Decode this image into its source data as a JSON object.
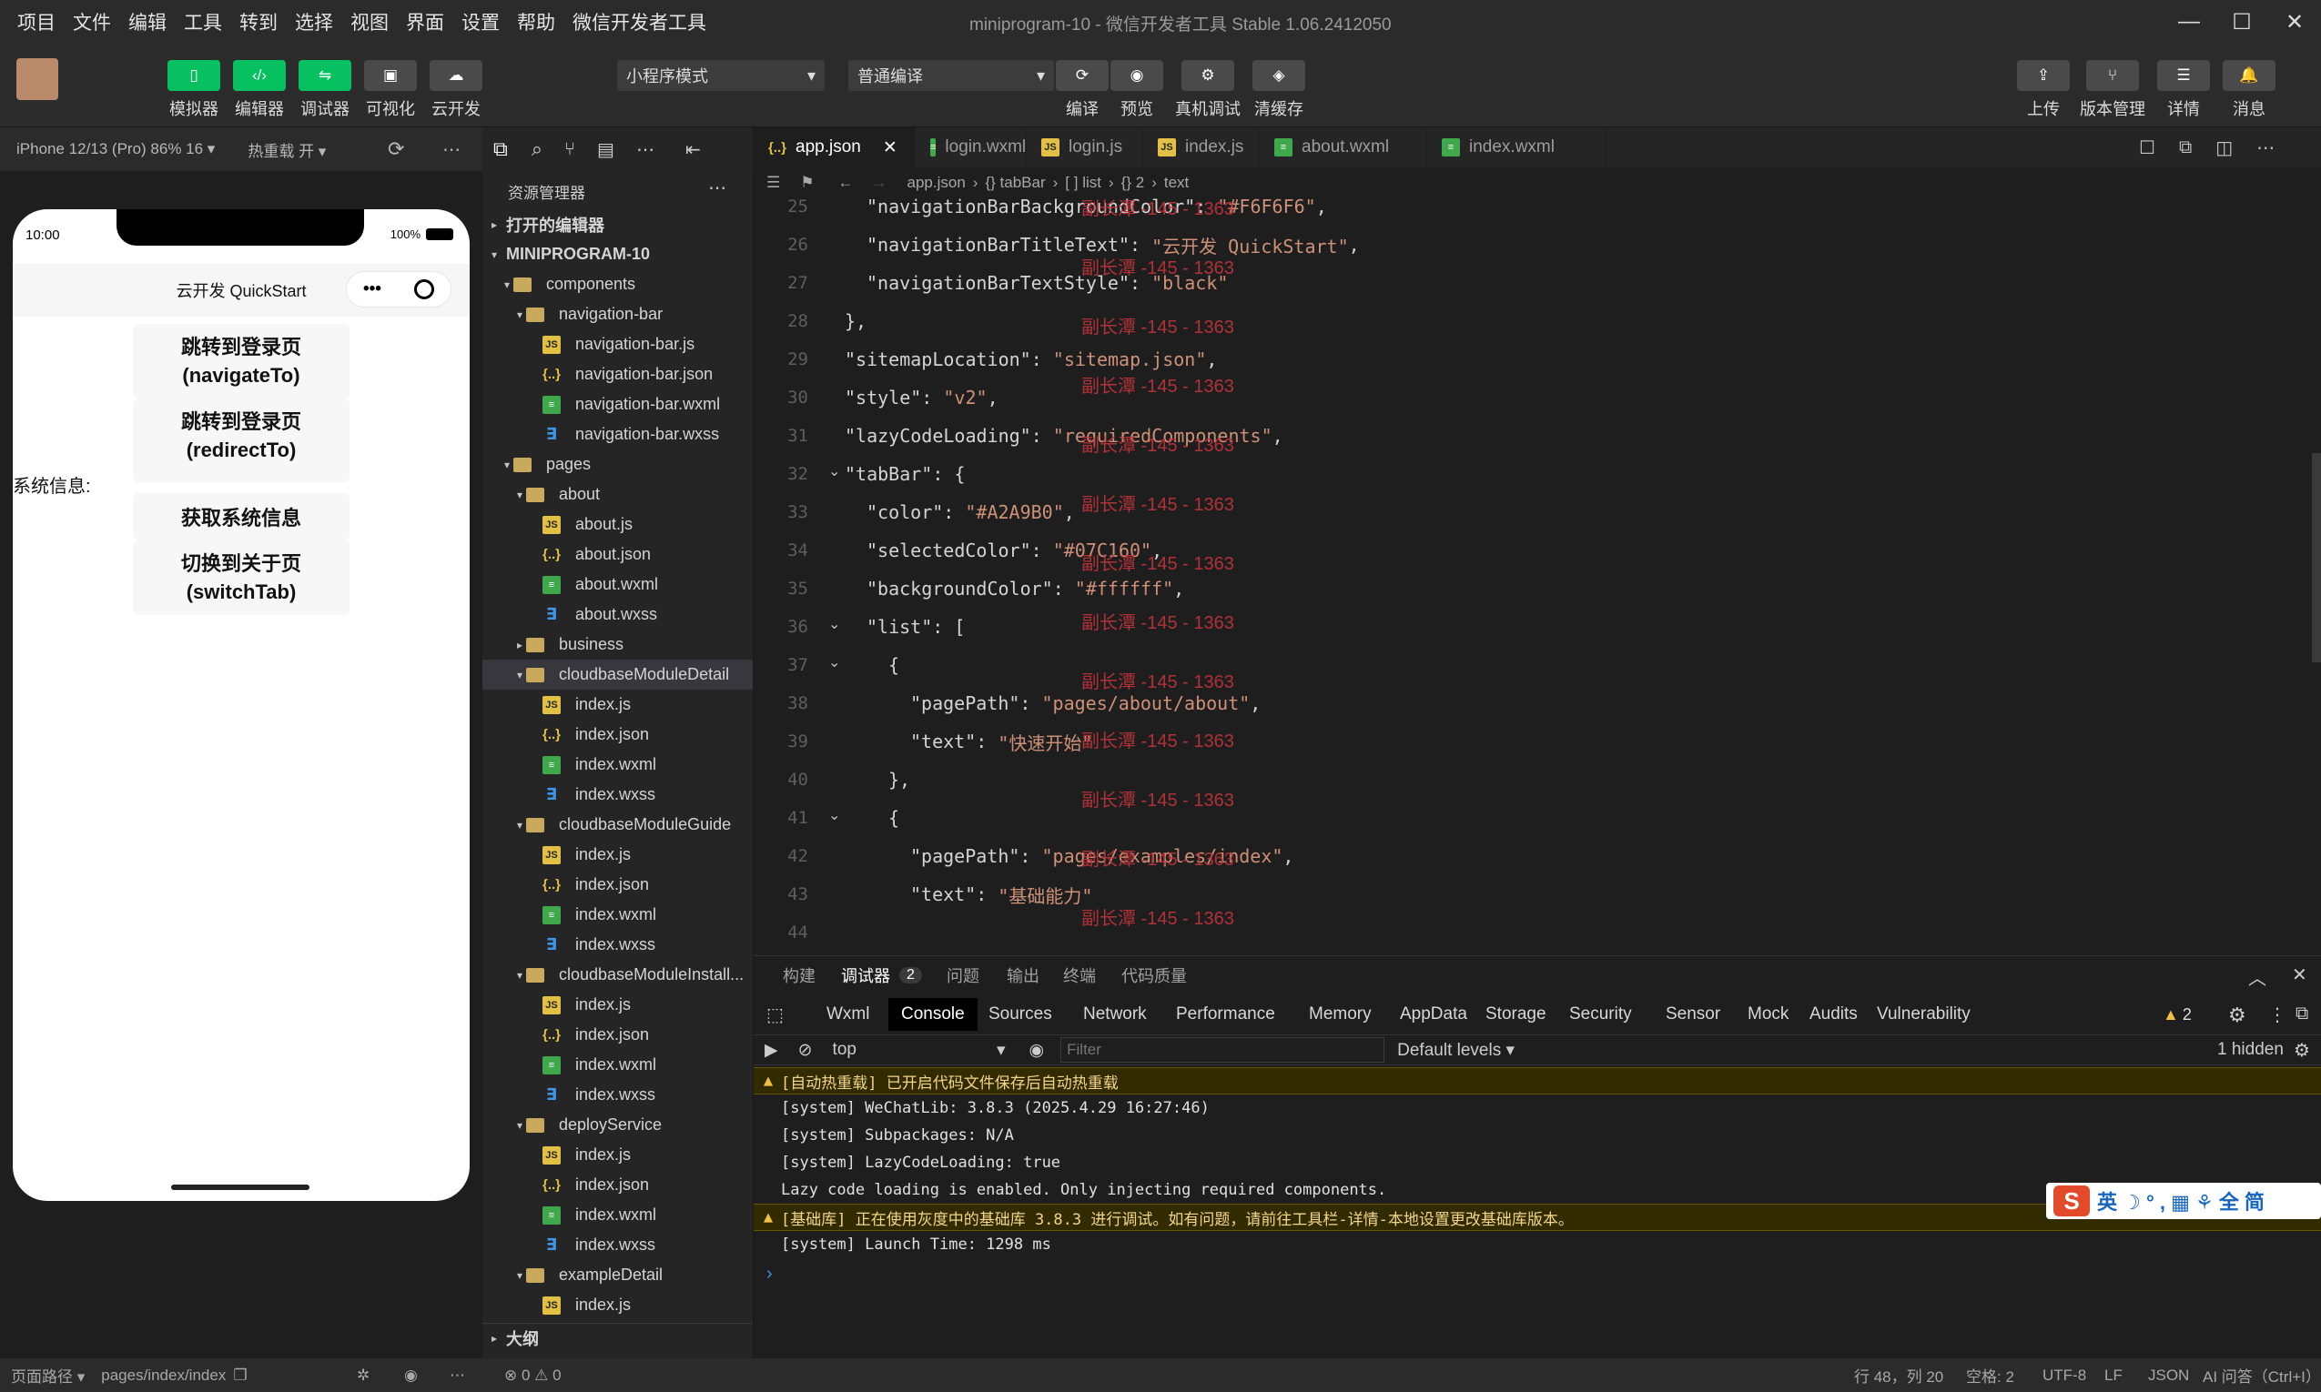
{
  "menu": [
    "项目",
    "文件",
    "编辑",
    "工具",
    "转到",
    "选择",
    "视图",
    "界面",
    "设置",
    "帮助",
    "微信开发者工具"
  ],
  "window_title": "miniprogram-10 - 微信开发者工具 Stable 1.06.2412050",
  "toolbar": {
    "left_buttons": [
      "模拟器",
      "编辑器",
      "调试器",
      "可视化",
      "云开发"
    ],
    "mode_select": "小程序模式",
    "compile_select": "普通编译",
    "mid_buttons": [
      "编译",
      "预览",
      "真机调试",
      "清缓存"
    ],
    "right_buttons": [
      "上传",
      "版本管理",
      "详情",
      "消息"
    ]
  },
  "simbar": {
    "device": "iPhone 12/13 (Pro) 86% 16 ▾",
    "hot_reload": "热重载 开 ▾"
  },
  "phone": {
    "time": "10:00",
    "battery": "100%",
    "title": "云开发 QuickStart",
    "buttons": [
      "跳转到登录页\n(navigateTo)",
      "跳转到登录页\n(redirectTo)",
      "获取系统信息",
      "切换到关于页\n(switchTab)"
    ],
    "sysinfo_label": "系统信息:"
  },
  "simfoot": {
    "path_label": "页面路径 ▾",
    "path": "pages/index/index"
  },
  "explorer": {
    "header": "资源管理器",
    "open_editors": "打开的编辑器",
    "project": "MINIPROGRAM-10",
    "outline": "大纲",
    "tree": [
      {
        "depth": 1,
        "type": "folder",
        "open": true,
        "name": "components"
      },
      {
        "depth": 2,
        "type": "folder",
        "open": true,
        "name": "navigation-bar"
      },
      {
        "depth": 3,
        "type": "js",
        "name": "navigation-bar.js"
      },
      {
        "depth": 3,
        "type": "json",
        "name": "navigation-bar.json"
      },
      {
        "depth": 3,
        "type": "wxml",
        "name": "navigation-bar.wxml"
      },
      {
        "depth": 3,
        "type": "wxss",
        "name": "navigation-bar.wxss"
      },
      {
        "depth": 1,
        "type": "folder",
        "open": true,
        "name": "pages"
      },
      {
        "depth": 2,
        "type": "folder",
        "open": true,
        "name": "about"
      },
      {
        "depth": 3,
        "type": "js",
        "name": "about.js"
      },
      {
        "depth": 3,
        "type": "json",
        "name": "about.json"
      },
      {
        "depth": 3,
        "type": "wxml",
        "name": "about.wxml"
      },
      {
        "depth": 3,
        "type": "wxss",
        "name": "about.wxss"
      },
      {
        "depth": 2,
        "type": "folder",
        "open": false,
        "name": "business"
      },
      {
        "depth": 2,
        "type": "folder",
        "open": true,
        "name": "cloudbaseModuleDetail",
        "selected": true
      },
      {
        "depth": 3,
        "type": "js",
        "name": "index.js"
      },
      {
        "depth": 3,
        "type": "json",
        "name": "index.json"
      },
      {
        "depth": 3,
        "type": "wxml",
        "name": "index.wxml"
      },
      {
        "depth": 3,
        "type": "wxss",
        "name": "index.wxss"
      },
      {
        "depth": 2,
        "type": "folder",
        "open": true,
        "name": "cloudbaseModuleGuide"
      },
      {
        "depth": 3,
        "type": "js",
        "name": "index.js"
      },
      {
        "depth": 3,
        "type": "json",
        "name": "index.json"
      },
      {
        "depth": 3,
        "type": "wxml",
        "name": "index.wxml"
      },
      {
        "depth": 3,
        "type": "wxss",
        "name": "index.wxss"
      },
      {
        "depth": 2,
        "type": "folder",
        "open": true,
        "name": "cloudbaseModuleInstall..."
      },
      {
        "depth": 3,
        "type": "js",
        "name": "index.js"
      },
      {
        "depth": 3,
        "type": "json",
        "name": "index.json"
      },
      {
        "depth": 3,
        "type": "wxml",
        "name": "index.wxml"
      },
      {
        "depth": 3,
        "type": "wxss",
        "name": "index.wxss"
      },
      {
        "depth": 2,
        "type": "folder",
        "open": true,
        "name": "deployService"
      },
      {
        "depth": 3,
        "type": "js",
        "name": "index.js"
      },
      {
        "depth": 3,
        "type": "json",
        "name": "index.json"
      },
      {
        "depth": 3,
        "type": "wxml",
        "name": "index.wxml"
      },
      {
        "depth": 3,
        "type": "wxss",
        "name": "index.wxss"
      },
      {
        "depth": 2,
        "type": "folder",
        "open": true,
        "name": "exampleDetail"
      },
      {
        "depth": 3,
        "type": "js",
        "name": "index.js"
      }
    ]
  },
  "editor": {
    "tabs": [
      {
        "name": "app.json",
        "type": "json",
        "active": true
      },
      {
        "name": "login.wxml",
        "type": "wxml"
      },
      {
        "name": "login.js",
        "type": "js"
      },
      {
        "name": "index.js",
        "type": "js"
      },
      {
        "name": "about.wxml",
        "type": "wxml"
      },
      {
        "name": "index.wxml",
        "type": "wxml"
      }
    ],
    "breadcrumb": [
      "app.json",
      "{} tabBar",
      "[ ] list",
      "{} 2",
      "text"
    ],
    "code": [
      {
        "n": "25",
        "indent": 1,
        "parts": [
          [
            "k",
            "\"navigationBarBackgroundColor\""
          ],
          [
            "p",
            ": "
          ],
          [
            "s",
            "\"#F6F6F6\""
          ],
          [
            "p",
            ","
          ]
        ]
      },
      {
        "n": "26",
        "indent": 1,
        "parts": [
          [
            "k",
            "\"navigationBarTitleText\""
          ],
          [
            "p",
            ": "
          ],
          [
            "s",
            "\"云开发 QuickStart\""
          ],
          [
            "p",
            ","
          ]
        ]
      },
      {
        "n": "27",
        "indent": 1,
        "parts": [
          [
            "k",
            "\"navigationBarTextStyle\""
          ],
          [
            "p",
            ": "
          ],
          [
            "s",
            "\"black\""
          ]
        ]
      },
      {
        "n": "28",
        "indent": 0,
        "parts": [
          [
            "p",
            "},"
          ]
        ]
      },
      {
        "n": "29",
        "indent": 0,
        "parts": [
          [
            "k",
            "\"sitemapLocation\""
          ],
          [
            "p",
            ": "
          ],
          [
            "s",
            "\"sitemap.json\""
          ],
          [
            "p",
            ","
          ]
        ]
      },
      {
        "n": "30",
        "indent": 0,
        "parts": [
          [
            "k",
            "\"style\""
          ],
          [
            "p",
            ": "
          ],
          [
            "s",
            "\"v2\""
          ],
          [
            "p",
            ","
          ]
        ]
      },
      {
        "n": "31",
        "indent": 0,
        "parts": [
          [
            "k",
            "\"lazyCodeLoading\""
          ],
          [
            "p",
            ": "
          ],
          [
            "s",
            "\"requiredComponents\""
          ],
          [
            "p",
            ","
          ]
        ]
      },
      {
        "n": "32",
        "indent": 0,
        "parts": [
          [
            "k",
            "\"tabBar\""
          ],
          [
            "p",
            ": {"
          ]
        ]
      },
      {
        "n": "33",
        "indent": 1,
        "parts": [
          [
            "k",
            "\"color\""
          ],
          [
            "p",
            ": "
          ],
          [
            "s",
            "\"#A2A9B0\""
          ],
          [
            "p",
            ","
          ]
        ]
      },
      {
        "n": "34",
        "indent": 1,
        "parts": [
          [
            "k",
            "\"selectedColor\""
          ],
          [
            "p",
            ": "
          ],
          [
            "s",
            "\"#07C160\""
          ],
          [
            "p",
            ","
          ]
        ]
      },
      {
        "n": "35",
        "indent": 1,
        "parts": [
          [
            "k",
            "\"backgroundColor\""
          ],
          [
            "p",
            ": "
          ],
          [
            "s",
            "\"#ffffff\""
          ],
          [
            "p",
            ","
          ]
        ]
      },
      {
        "n": "36",
        "indent": 1,
        "parts": [
          [
            "k",
            "\"list\""
          ],
          [
            "p",
            ": ["
          ]
        ]
      },
      {
        "n": "37",
        "indent": 2,
        "parts": [
          [
            "p",
            "{"
          ]
        ]
      },
      {
        "n": "38",
        "indent": 3,
        "parts": [
          [
            "k",
            "\"pagePath\""
          ],
          [
            "p",
            ": "
          ],
          [
            "s",
            "\"pages/about/about\""
          ],
          [
            "p",
            ","
          ]
        ]
      },
      {
        "n": "39",
        "indent": 3,
        "parts": [
          [
            "k",
            "\"text\""
          ],
          [
            "p",
            ": "
          ],
          [
            "s",
            "\"快速开始\""
          ]
        ]
      },
      {
        "n": "40",
        "indent": 2,
        "parts": [
          [
            "p",
            "},"
          ]
        ]
      },
      {
        "n": "41",
        "indent": 2,
        "parts": [
          [
            "p",
            "{"
          ]
        ]
      },
      {
        "n": "42",
        "indent": 3,
        "parts": [
          [
            "k",
            "\"pagePath\""
          ],
          [
            "p",
            ": "
          ],
          [
            "s",
            "\"pages/examples/index\""
          ],
          [
            "p",
            ","
          ]
        ]
      },
      {
        "n": "43",
        "indent": 3,
        "parts": [
          [
            "k",
            "\"text\""
          ],
          [
            "p",
            ": "
          ],
          [
            "s",
            "\"基础能力\""
          ]
        ]
      },
      {
        "n": "44",
        "indent": 3,
        "parts": []
      }
    ],
    "watermark": "副长潭 -145 - 1363"
  },
  "panel": {
    "tabs": [
      "构建",
      "调试器",
      "问题",
      "输出",
      "终端",
      "代码质量"
    ],
    "debugger_badge": "2",
    "devtools_tabs": [
      "Wxml",
      "Console",
      "Sources",
      "Network",
      "Performance",
      "Memory",
      "AppData",
      "Storage",
      "Security",
      "Sensor",
      "Mock",
      "Audits",
      "Vulnerability"
    ],
    "warn_count": "2",
    "context": "top",
    "filter_placeholder": "Filter",
    "levels": "Default levels ▾",
    "hidden": "1 hidden",
    "console": [
      {
        "type": "warn",
        "text": "[自动热重载] 已开启代码文件保存后自动热重载"
      },
      {
        "type": "log",
        "text": "[system] WeChatLib: 3.8.3 (2025.4.29 16:27:46)"
      },
      {
        "type": "log",
        "text": "[system] Subpackages: N/A"
      },
      {
        "type": "log",
        "text": "[system] LazyCodeLoading: true"
      },
      {
        "type": "log",
        "text": "Lazy code loading is enabled. Only injecting required components."
      },
      {
        "type": "warn",
        "text": "[基础库] 正在使用灰度中的基础库 3.8.3 进行调试。如有问题，请前往工具栏-详情-本地设置更改基础库版本。"
      },
      {
        "type": "log",
        "text": "[system] Launch Time: 1298 ms"
      }
    ]
  },
  "statusbar": {
    "errors": "⊗ 0 ⚠ 0",
    "position": "行 48，列 20",
    "spaces": "空格: 2",
    "encoding": "UTF-8",
    "eol": "LF",
    "lang": "JSON",
    "ai": "AI 问答（Ctrl+I）"
  },
  "ime": "英 ☽ ° , ▦ ⚘ 全 简"
}
